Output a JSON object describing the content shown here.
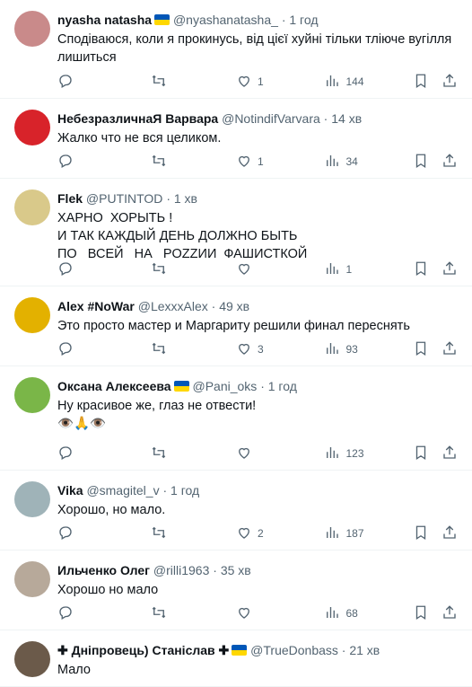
{
  "tweets": [
    {
      "name": "nyasha natasha",
      "flag": true,
      "handle": "@nyashanatasha_",
      "time": "1 год",
      "text": "Сподіваюся, коли я прокинусь, від цієї хуйні тільки тліюче вугілля лишиться",
      "replies": "",
      "retweets": "",
      "likes": "1",
      "views": "144",
      "avatar_color": "#c98a8a"
    },
    {
      "name": "НебезразличнаЯ Варвара",
      "flag": false,
      "handle": "@NotindifVarvara",
      "time": "14 хв",
      "text": "Жалко что не вся целиком.",
      "replies": "",
      "retweets": "",
      "likes": "1",
      "views": "34",
      "avatar_color": "#d8232a"
    },
    {
      "name": "Flek",
      "flag": false,
      "handle": "@PUTINTOD",
      "time": "1 хв",
      "text": "ХАРНО  ХОРЫТЬ !\nИ ТАК КАЖДЫЙ ДЕНЬ ДОЛЖНО БЫТЬ\nПО   ВСЕЙ   НА   POZZИИ  ФАШИСТКОЙ",
      "replies": "",
      "retweets": "",
      "likes": "",
      "views": "1",
      "avatar_color": "#d9c98a"
    },
    {
      "name": "Alex #NoWar",
      "flag": false,
      "handle": "@LexxxAlex",
      "time": "49 хв",
      "text": "Это просто мастер и Маргариту решили финал переснять",
      "replies": "",
      "retweets": "",
      "likes": "3",
      "views": "93",
      "avatar_color": "#e3b100"
    },
    {
      "name": "Оксана Алексеева",
      "flag": true,
      "handle": "@Pani_oks",
      "time": "1 год",
      "text": "Ну красивое же, глаз не отвести!\n👁️🙏👁️",
      "replies": "",
      "retweets": "",
      "likes": "",
      "views": "123",
      "avatar_color": "#7ab648"
    },
    {
      "name": "Vika",
      "flag": false,
      "handle": "@smagitel_v",
      "time": "1 год",
      "text": "Хорошо, но мало.",
      "replies": "",
      "retweets": "",
      "likes": "2",
      "views": "187",
      "avatar_color": "#9fb3b8"
    },
    {
      "name": "Ильченко Олег",
      "flag": false,
      "handle": "@rilli1963",
      "time": "35 хв",
      "text": "Хорошо но мало",
      "replies": "",
      "retweets": "",
      "likes": "",
      "views": "68",
      "avatar_color": "#b7a99a"
    },
    {
      "name": "✚ Дніпровець) Станіслав ✚",
      "flag": true,
      "handle": "@TrueDonbass",
      "time": "21 хв",
      "text": "Мало",
      "replies": "",
      "retweets": "",
      "likes": "",
      "views": "",
      "avatar_color": "#6b5a4a"
    }
  ],
  "separator": "·"
}
